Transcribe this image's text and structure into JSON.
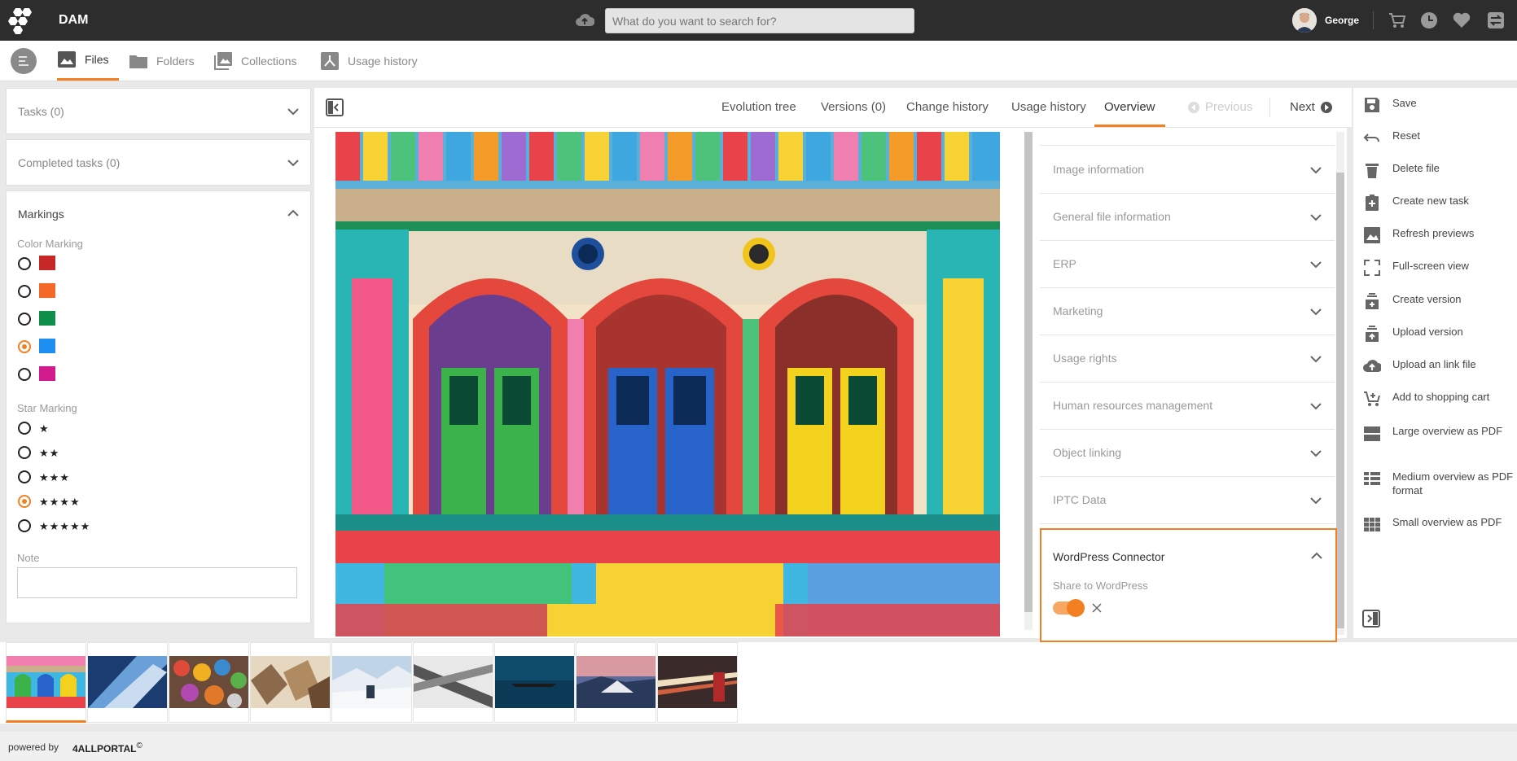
{
  "header": {
    "app_title": "DAM",
    "search_placeholder": "What do you want to search for?",
    "username": "George",
    "icons": [
      "logo-icon",
      "upload-icon",
      "cart-icon",
      "clock-icon",
      "heart-icon",
      "swap-icon"
    ]
  },
  "nav": {
    "tabs": [
      {
        "label": "Files",
        "active": true
      },
      {
        "label": "Folders",
        "active": false
      },
      {
        "label": "Collections",
        "active": false
      },
      {
        "label": "Usage history",
        "active": false
      }
    ]
  },
  "left": {
    "tasks": "Tasks (0)",
    "completed": "Completed tasks (0)",
    "markings": "Markings",
    "color_marking": "Color Marking",
    "colors": [
      {
        "hex": "#c62828",
        "selected": false
      },
      {
        "hex": "#f4692a",
        "selected": false
      },
      {
        "hex": "#0f8f4a",
        "selected": false
      },
      {
        "hex": "#1e8ff0",
        "selected": true
      },
      {
        "hex": "#d21c8e",
        "selected": false
      }
    ],
    "star_marking": "Star Marking",
    "stars": [
      {
        "label": "★",
        "selected": false
      },
      {
        "label": "★★",
        "selected": false
      },
      {
        "label": "★★★",
        "selected": false
      },
      {
        "label": "★★★★",
        "selected": true
      },
      {
        "label": "★★★★★",
        "selected": false
      }
    ],
    "note_label": "Note",
    "note_value": ""
  },
  "center": {
    "tabs": [
      {
        "label": "Evolution tree"
      },
      {
        "label": "Versions (0)"
      },
      {
        "label": "Change history"
      },
      {
        "label": "Usage history"
      },
      {
        "label": "Overview"
      }
    ],
    "previous": "Previous",
    "next": "Next"
  },
  "info": {
    "sections": [
      "Image information",
      "General file information",
      "ERP",
      "Marketing",
      "Usage rights",
      "Human resources management",
      "Object linking",
      "IPTC Data"
    ],
    "wordpress": {
      "title": "WordPress Connector",
      "share_label": "Share to WordPress",
      "share_on": true
    }
  },
  "actions": [
    {
      "label": "Save",
      "icon": "save-icon"
    },
    {
      "label": "Reset",
      "icon": "undo-icon"
    },
    {
      "label": "Delete file",
      "icon": "trash-icon"
    },
    {
      "label": "Create new task",
      "icon": "task-icon"
    },
    {
      "label": "Refresh previews",
      "icon": "image-refresh-icon"
    },
    {
      "label": "Full-screen view",
      "icon": "fullscreen-icon"
    },
    {
      "label": "Create version",
      "icon": "version-icon"
    },
    {
      "label": "Upload version",
      "icon": "upload-version-icon"
    },
    {
      "label": "Upload an link file",
      "icon": "cloud-upload-icon"
    },
    {
      "label": "Add to shopping cart",
      "icon": "cart-add-icon"
    },
    {
      "label": "Large overview as PDF",
      "icon": "large-overview-icon"
    },
    {
      "label": "Medium overview as PDF format",
      "icon": "medium-overview-icon"
    },
    {
      "label": "Small overview as PDF",
      "icon": "small-overview-icon"
    }
  ],
  "filmstrip": {
    "count": 9,
    "active_index": 0
  },
  "footer": {
    "powered_by": "powered by",
    "brand": "4ALLPORTAL",
    "copyright": "©"
  },
  "colors": {
    "accent": "#f47f20",
    "topbar": "#2d2d2d"
  }
}
